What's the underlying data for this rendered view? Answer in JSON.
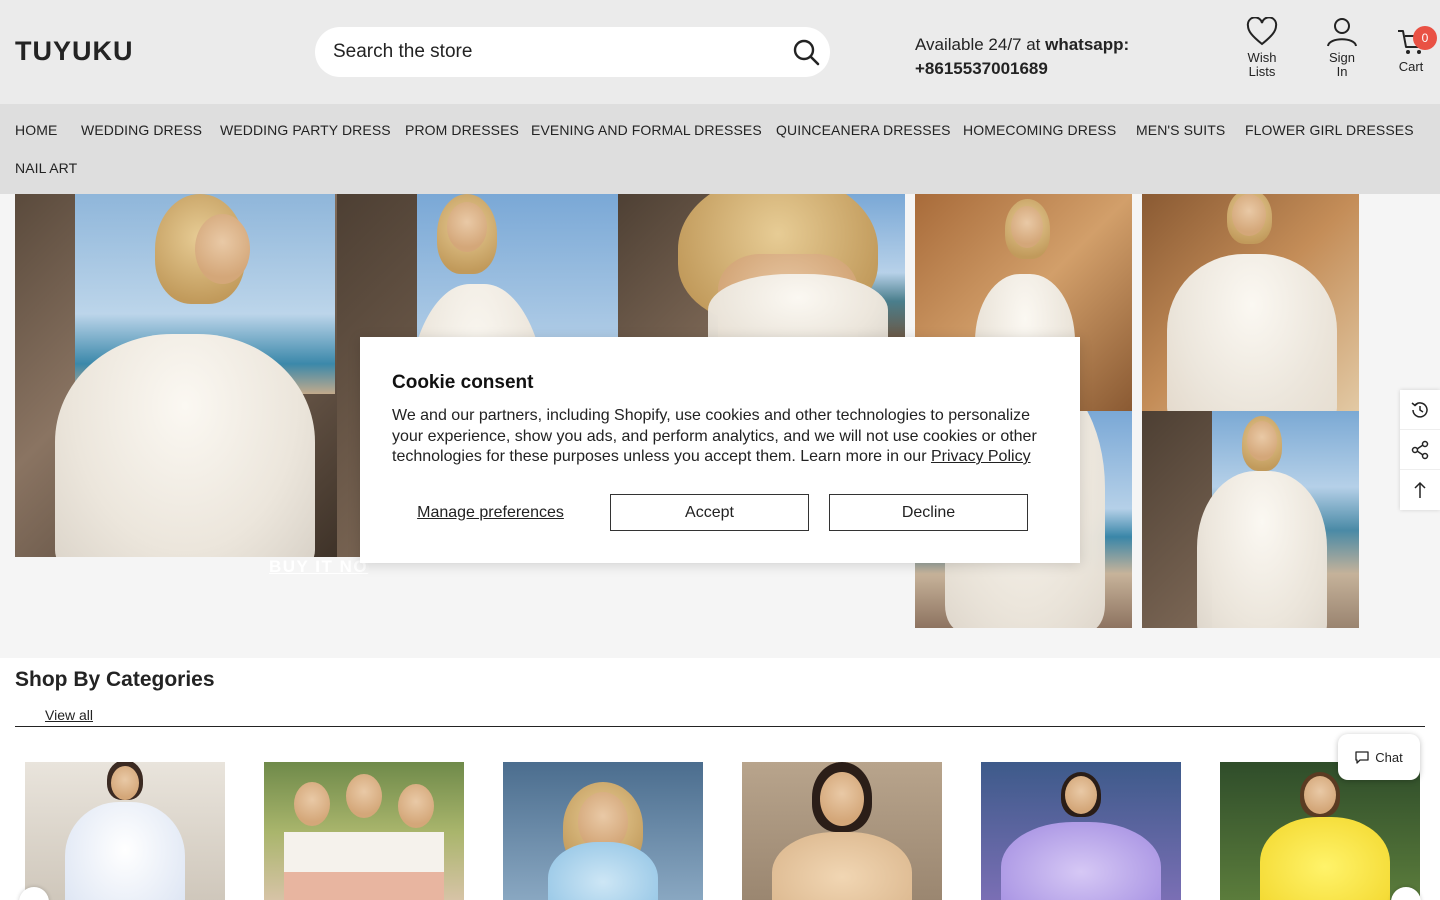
{
  "header": {
    "logo": "TUYUKU",
    "search_placeholder": "Search the store",
    "contact_prefix": "Available 24/7 at ",
    "contact_channel": "whatsapp:",
    "contact_phone": "+8615537001689",
    "wishlist_label_1": "Wish",
    "wishlist_label_2": "Lists",
    "signin_label_1": "Sign",
    "signin_label_2": "In",
    "cart_label": "Cart",
    "cart_count": "0"
  },
  "nav": {
    "items": [
      "HOME",
      "WEDDING DRESS",
      "WEDDING PARTY DRESS",
      "PROM DRESSES",
      "EVENING AND FORMAL DRESSES",
      "QUINCEANERA DRESSES",
      "HOMECOMING DRESS",
      "MEN'S SUITS",
      "FLOWER GIRL DRESSES",
      "NAIL ART"
    ]
  },
  "hero": {
    "cta": "BUY IT NO"
  },
  "cookie": {
    "title": "Cookie consent",
    "body": "We and our partners, including Shopify, use cookies and other technologies to personalize your experience, show you ads, and perform analytics, and we will not use cookies or other technologies for these purposes unless you accept them. Learn more in our ",
    "policy_link": "Privacy Policy",
    "manage": "Manage preferences",
    "accept": "Accept",
    "decline": "Decline"
  },
  "categories": {
    "title": "Shop By Categories",
    "view_all": "View all"
  },
  "chat": {
    "label": "Chat"
  },
  "icons": {
    "search": "search-icon",
    "wishlist": "heart-icon",
    "account": "user-icon",
    "cart": "cart-icon",
    "recent": "history-icon",
    "share": "share-icon",
    "top": "arrow-up-icon",
    "chat": "chat-bubble-icon"
  },
  "colors": {
    "header_bg": "#ebebeb",
    "nav_bg": "#dedede",
    "cart_badge": "#e95144"
  }
}
